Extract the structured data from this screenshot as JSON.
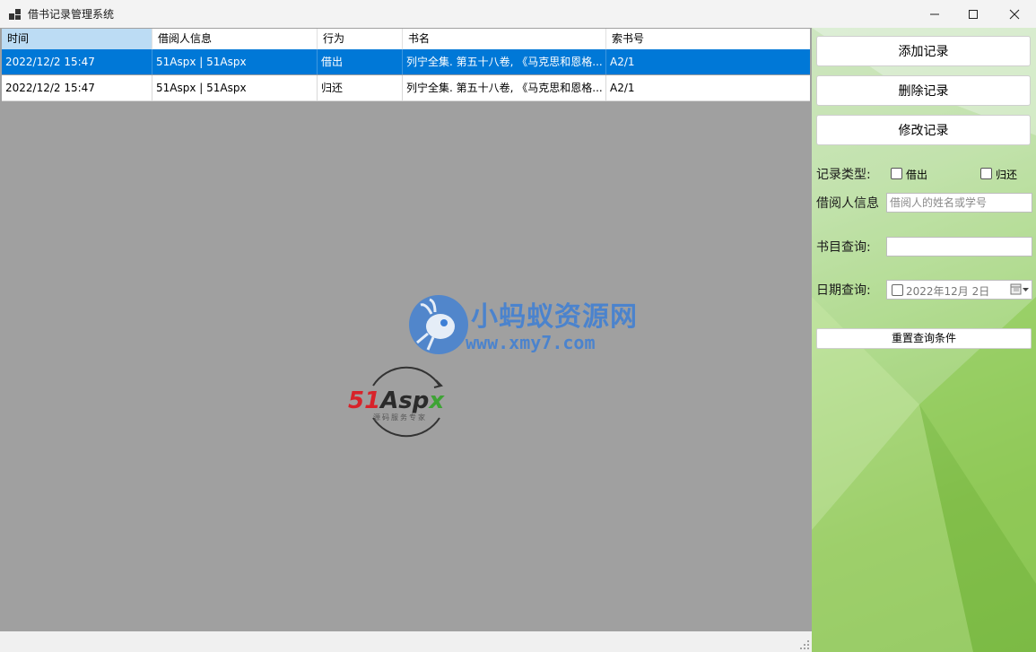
{
  "window": {
    "title": "借书记录管理系统"
  },
  "grid": {
    "columns": [
      "时间",
      "借阅人信息",
      "行为",
      "书名",
      "索书号"
    ],
    "rows": [
      {
        "time": "2022/12/2 15:47",
        "borrower": "51Aspx | 51Aspx",
        "action": "借出",
        "book": "列宁全集. 第五十八卷, 《马克思和恩格...",
        "callno": "A2/1",
        "selected": true
      },
      {
        "time": "2022/12/2 15:47",
        "borrower": "51Aspx | 51Aspx",
        "action": "归还",
        "book": "列宁全集. 第五十八卷, 《马克思和恩格...",
        "callno": "A2/1",
        "selected": false
      }
    ]
  },
  "watermarks": {
    "site_name": "小蚂蚁资源网",
    "site_url": "www.xmy7.com",
    "aspx_red": "51",
    "aspx_dark": "Asp",
    "aspx_green": "x",
    "aspx_sub": "源码服务专家"
  },
  "panel": {
    "add_label": "添加记录",
    "delete_label": "删除记录",
    "edit_label": "修改记录",
    "record_type_label": "记录类型:",
    "borrow_label": "借出",
    "return_label": "归还",
    "borrower_label": "借阅人信息",
    "borrower_placeholder": "借阅人的姓名或学号",
    "borrower_value": "",
    "book_query_label": "书目查询:",
    "book_query_value": "",
    "date_query_label": "日期查询:",
    "date_value": "2022年12月  2日",
    "reset_label": "重置查询条件"
  },
  "colors": {
    "selection": "#0078d7",
    "header_selected": "#bcdcf4",
    "grid_background": "#a0a0a0",
    "panel_green": "#8cc554"
  }
}
